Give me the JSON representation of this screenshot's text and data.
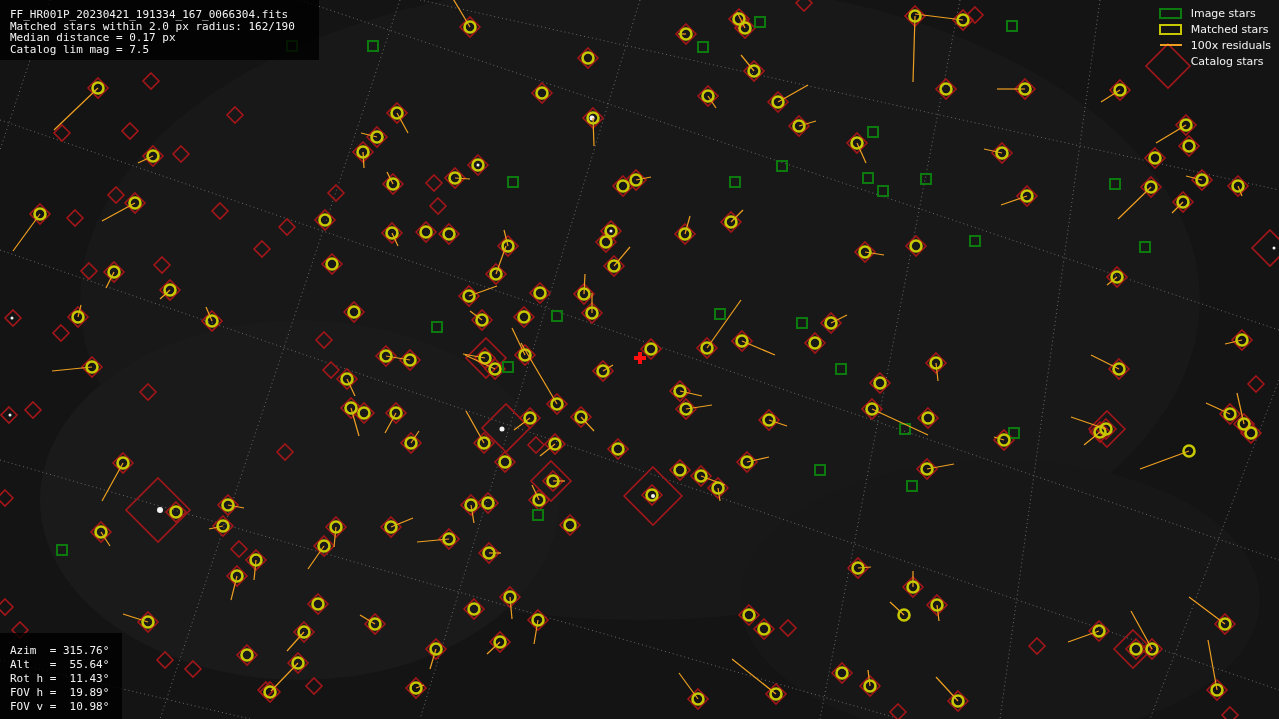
{
  "info": {
    "lines": [
      "FF_HR001P_20230421_191334_167_0066304.fits",
      "Matched stars within 2.0 px radius: 162/190",
      "Median distance = 0.17 px",
      "Catalog lim mag = 7.5"
    ]
  },
  "legend": [
    {
      "label": "Image stars"
    },
    {
      "label": "Matched stars",
      "kind": "matched"
    },
    {
      "label": "100x residuals",
      "kind": "residual"
    },
    {
      "label": "Catalog stars",
      "kind": "catalog"
    }
  ],
  "pointing": {
    "lines": [
      "Azim  = 315.76°",
      "Alt   =  55.64°",
      "Rot h =  11.43°",
      "FOV h =  19.89°",
      "FOV v =  10.98°"
    ]
  }
}
